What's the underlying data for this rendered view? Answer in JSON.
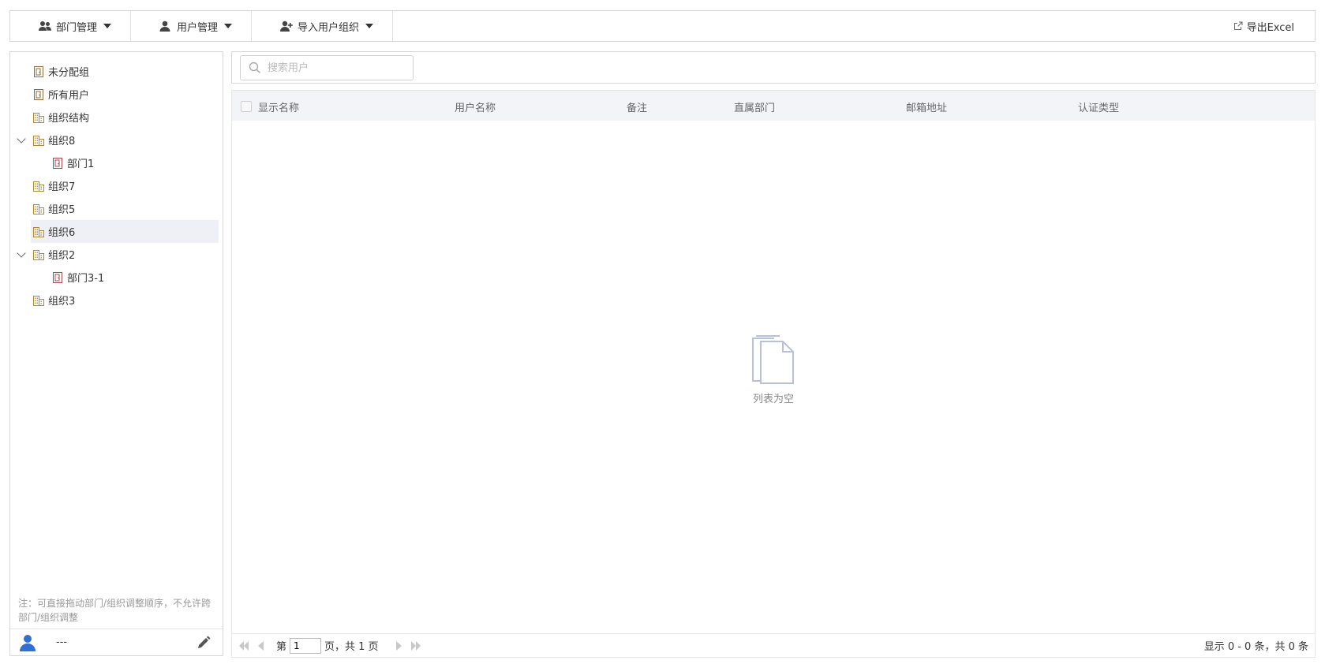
{
  "toolbar": {
    "dept_mgmt": "部门管理",
    "user_mgmt": "用户管理",
    "import_org": "导入用户组织",
    "export_excel": "导出Excel"
  },
  "tree": {
    "nodes": [
      {
        "label": "未分配组",
        "icon": "group-icon"
      },
      {
        "label": "所有用户",
        "icon": "group-icon"
      },
      {
        "label": "组织结构",
        "icon": "building-icon"
      },
      {
        "label": "组织8",
        "icon": "building-icon",
        "expanded": true
      },
      {
        "label": "部门1",
        "icon": "department-icon"
      },
      {
        "label": "组织7",
        "icon": "building-icon"
      },
      {
        "label": "组织5",
        "icon": "building-icon"
      },
      {
        "label": "组织6",
        "icon": "building-icon",
        "selected": true
      },
      {
        "label": "组织2",
        "icon": "building-icon",
        "expanded": true
      },
      {
        "label": "部门3-1",
        "icon": "department-icon"
      },
      {
        "label": "组织3",
        "icon": "building-icon"
      }
    ]
  },
  "note": "注：可直接拖动部门/组织调整顺序，不允许跨部门/组织调整",
  "footer": {
    "username": "---"
  },
  "search": {
    "placeholder": "搜索用户"
  },
  "table": {
    "columns": [
      "显示名称",
      "用户名称",
      "备注",
      "直属部门",
      "邮箱地址",
      "认证类型"
    ],
    "empty_text": "列表为空"
  },
  "pager": {
    "prefix": "第",
    "page": "1",
    "suffix": "页，共 1 页",
    "info": "显示 0 - 0 条，共 0 条"
  },
  "colors": {
    "accent": "#3a7bd5",
    "border": "#d6d6d6",
    "header_bg": "#f3f4f8",
    "selected_bg": "#eef0f5"
  }
}
